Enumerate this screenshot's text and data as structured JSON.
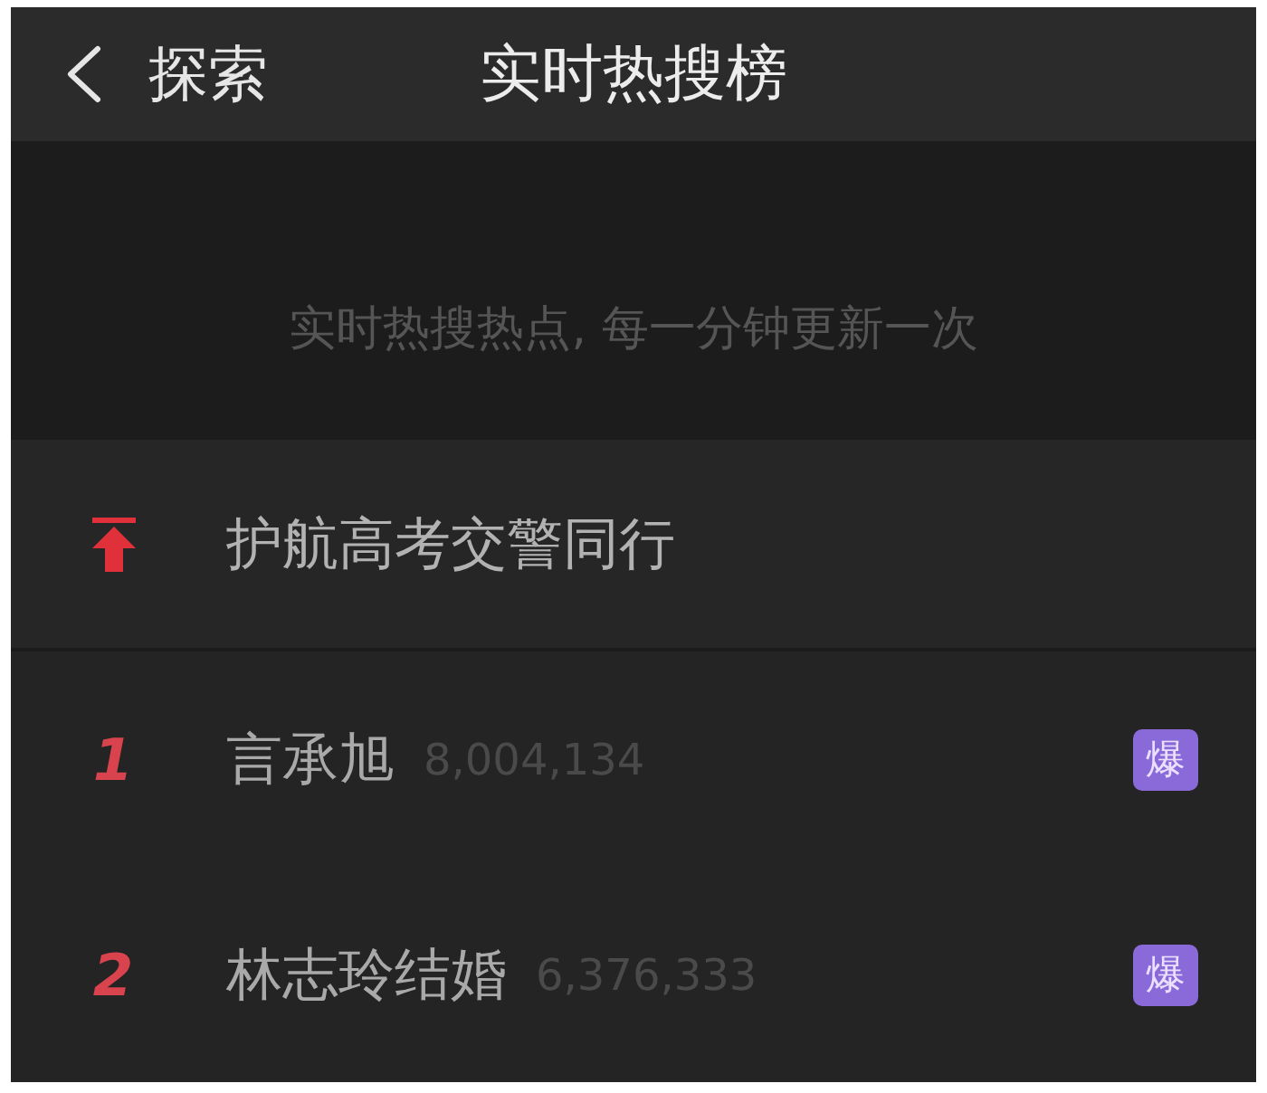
{
  "header": {
    "back_label": "探索",
    "title": "实时热搜榜"
  },
  "banner": {
    "text": "实时热搜热点, 每一分钟更新一次"
  },
  "pinned": {
    "title": "护航高考交警同行"
  },
  "entries": [
    {
      "rank": "1",
      "title": "言承旭",
      "count": "8,004,134",
      "badge": "爆"
    },
    {
      "rank": "2",
      "title": "林志玲结婚",
      "count": "6,376,333",
      "badge": "爆"
    }
  ]
}
